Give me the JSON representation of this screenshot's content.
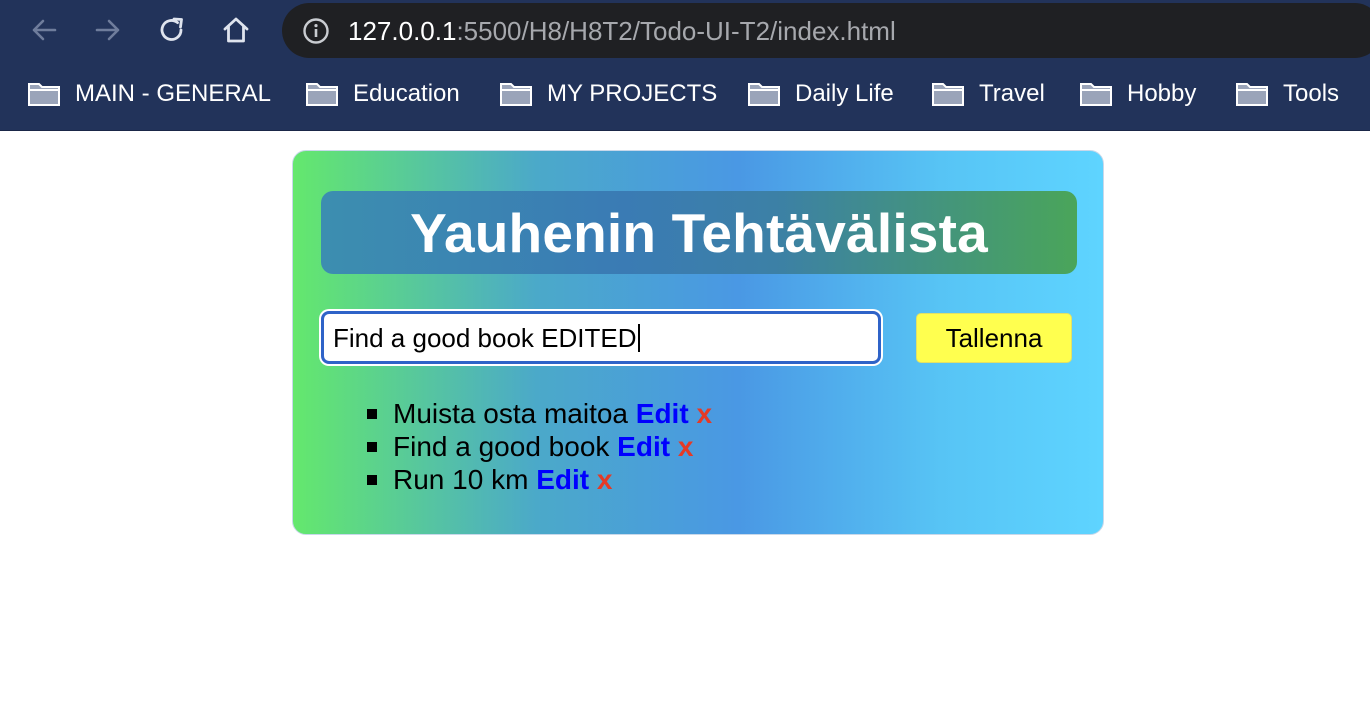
{
  "browser": {
    "url_host": "127.0.0.1",
    "url_path": ":5500/H8/H8T2/Todo-UI-T2/index.html",
    "bookmarks": [
      {
        "label": "MAIN - GENERAL",
        "icon": "folder-icon"
      },
      {
        "label": "Education",
        "icon": "folder-icon"
      },
      {
        "label": "MY PROJECTS",
        "icon": "folder-icon"
      },
      {
        "label": "Daily Life",
        "icon": "folder-icon"
      },
      {
        "label": "Travel",
        "icon": "folder-icon"
      },
      {
        "label": "Hobby",
        "icon": "folder-icon"
      },
      {
        "label": "Tools",
        "icon": "folder-icon"
      }
    ]
  },
  "app": {
    "title": "Yauhenin Tehtävälista",
    "input_value": "Find a good book EDITED",
    "save_label": "Tallenna",
    "tasks": [
      {
        "text": "Muista osta maitoa",
        "edit": "Edit",
        "delete": "x"
      },
      {
        "text": "Find a good book",
        "edit": "Edit",
        "delete": "x"
      },
      {
        "text": "Run 10 km",
        "edit": "Edit",
        "delete": "x"
      }
    ]
  },
  "colors": {
    "chrome": "#22335a",
    "edit_link": "#0000ff",
    "delete_link": "#e53a26",
    "save_button": "#ffff4f"
  }
}
